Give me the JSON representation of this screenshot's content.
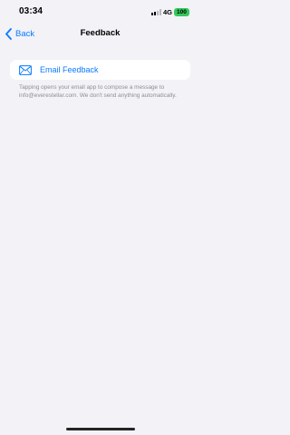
{
  "status_bar": {
    "time": "03:34",
    "network": "4G",
    "battery": "100",
    "icons": [
      "signal-bars-icon",
      "battery-icon"
    ]
  },
  "nav": {
    "back_label": "Back",
    "title": "Feedback",
    "icons": [
      "chevron-left-icon"
    ]
  },
  "feedback": {
    "email_label": "Email Feedback",
    "email_icon": "envelope-icon",
    "footnote": "Tapping opens your email app to compose a message to info@everestellar.com. We don't send anything automatically."
  },
  "colors": {
    "accent": "#0a7aff",
    "background": "#f2f2f7",
    "card": "#ffffff",
    "battery": "#34c759",
    "secondary_text": "#8e8e93"
  }
}
